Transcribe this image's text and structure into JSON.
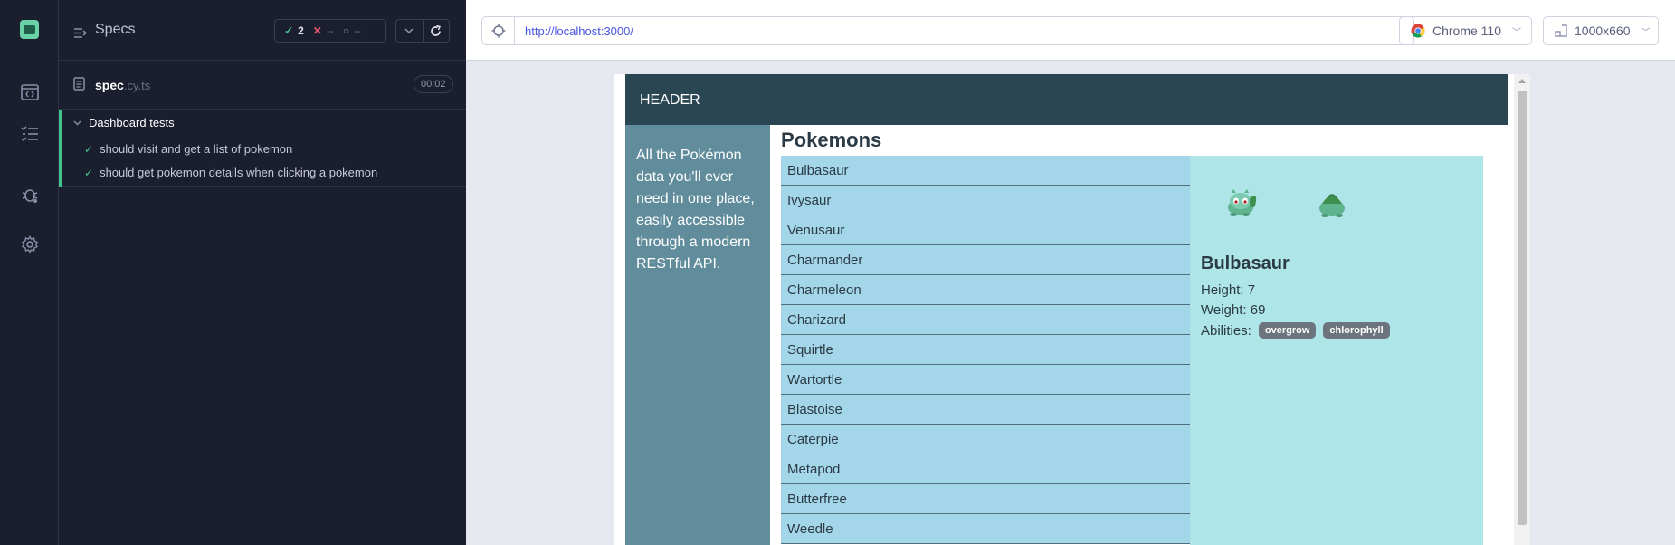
{
  "nav": {
    "items": [
      {
        "name": "app-logo",
        "icon": "cypress-logo-icon"
      },
      {
        "name": "runs",
        "icon": "code-window-icon"
      },
      {
        "name": "specs",
        "icon": "list-check-icon"
      },
      {
        "name": "debug",
        "icon": "bug-icon"
      },
      {
        "name": "settings",
        "icon": "gear-icon"
      }
    ]
  },
  "reporter": {
    "title": "Specs",
    "stats": {
      "passed": "2",
      "failed": "--",
      "pending": "--"
    },
    "spec": {
      "name": "spec",
      "ext": ".cy.ts",
      "duration": "00:02"
    },
    "suite": {
      "title": "Dashboard tests",
      "tests": [
        {
          "label": "should visit and get a list of pokemon",
          "status": "passed"
        },
        {
          "label": "should get pokemon details when clicking a pokemon",
          "status": "passed"
        }
      ]
    }
  },
  "browser": {
    "url": "http://localhost:3000/",
    "name": "Chrome 110",
    "viewport": "1000x660"
  },
  "app": {
    "header": "HEADER",
    "sidebar_text": "All the Pokémon data you'll ever need in one place, easily accessible through a modern RESTful API.",
    "title": "Pokemons",
    "pokemon_list": [
      "Bulbasaur",
      "Ivysaur",
      "Venusaur",
      "Charmander",
      "Charmeleon",
      "Charizard",
      "Squirtle",
      "Wartortle",
      "Blastoise",
      "Caterpie",
      "Metapod",
      "Butterfree",
      "Weedle"
    ],
    "detail": {
      "name": "Bulbasaur",
      "height": "Height: 7",
      "weight": "Weight: 69",
      "abilities_label": "Abilities:",
      "abilities": [
        "overgrow",
        "chlorophyll"
      ]
    }
  },
  "colors": {
    "pass": "#40c28f",
    "fail": "#e45770",
    "header_bg": "#2b4653",
    "sidebar_bg": "#608c9b",
    "list_bg": "#a4d6e9",
    "detail_bg": "#ade5e8"
  }
}
